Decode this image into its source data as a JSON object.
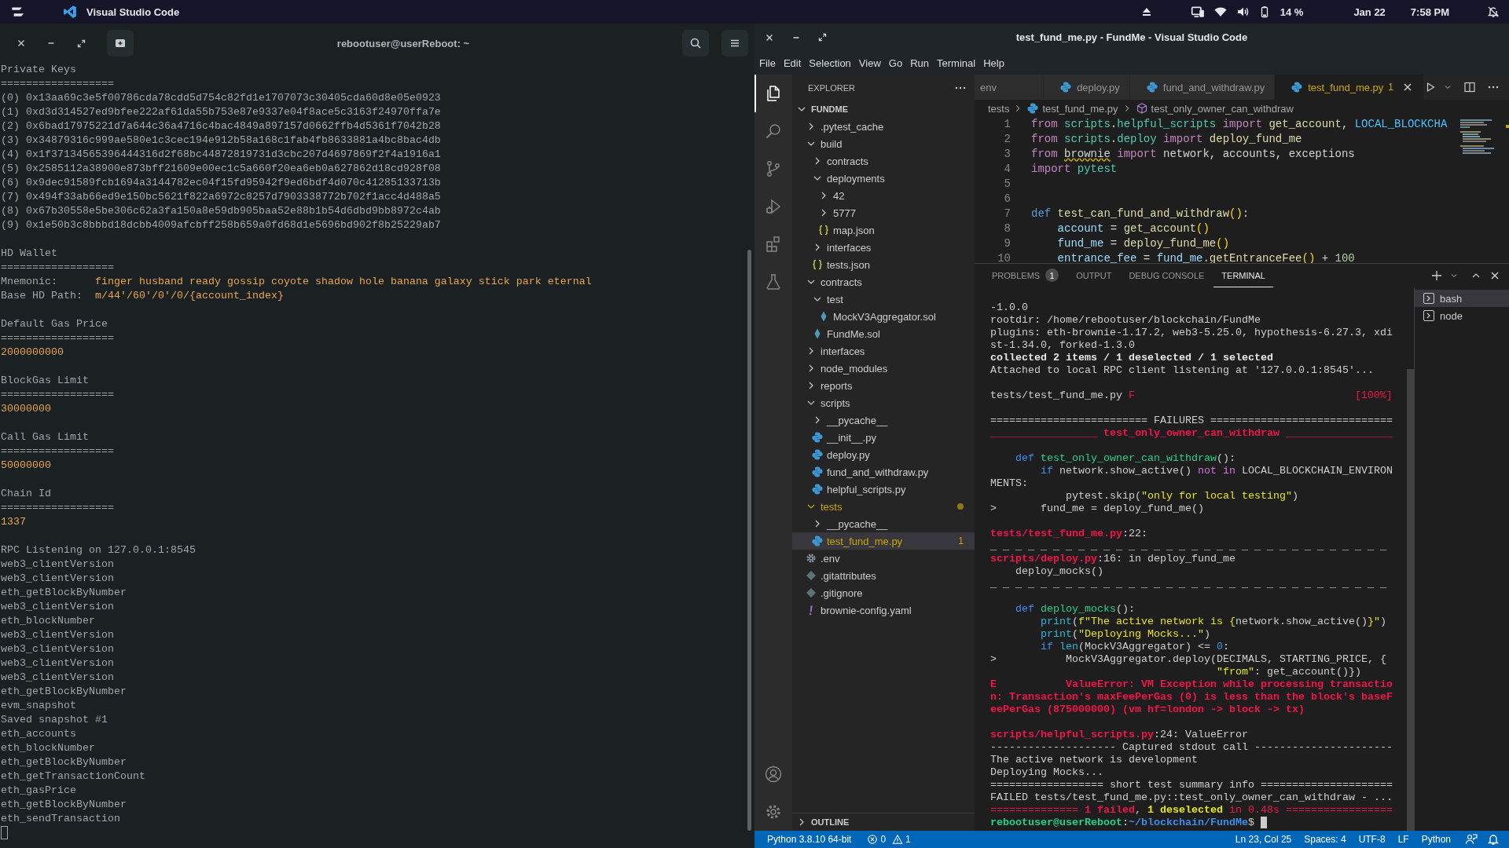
{
  "top_bar": {
    "app_name": "Visual Studio Code",
    "battery": "14 %",
    "date": "Jan 22",
    "time": "7:58 PM"
  },
  "terminal_window": {
    "title": "rebootuser@userReboot: ~",
    "lines": [
      {
        "kind": "plain",
        "text": "Private Keys"
      },
      {
        "kind": "plain",
        "text": "=================="
      },
      {
        "kind": "plain",
        "text": "(0) 0x13aa69c3e5f00786cda78cdd5d754c82fd1e1707073c30405cda60d8e05e0923"
      },
      {
        "kind": "plain",
        "text": "(1) 0xd3d314527ed9bfee222af61da55b753e87e9337e04f8ace5c3163f24970ffa7e"
      },
      {
        "kind": "plain",
        "text": "(2) 0x6bad17975221d7a644c36a4716c4bac4849a897157d0662ffb4d5361f7042b28"
      },
      {
        "kind": "plain",
        "text": "(3) 0x34879316c999ae580e1c3cec194e912b58a168c1fab4fb8633881a4bc8bac4db"
      },
      {
        "kind": "plain",
        "text": "(4) 0x1f37134565396444316d2f68bc44872819731d3cbc207d4697869f2f4a1916a1"
      },
      {
        "kind": "plain",
        "text": "(5) 0x2585112a38900e873bff21609e00ec1c5a660f20ea6eb0a627862d18cd928f08"
      },
      {
        "kind": "plain",
        "text": "(6) 0x9dec91589fcb1694a3144782ec04f15fd95942f9ed6bdf4d070c41285133713b"
      },
      {
        "kind": "plain",
        "text": "(7) 0x494f33ab66ed9e150bc5621f822a6972c8257d7903338772b702f1acc4d488a5"
      },
      {
        "kind": "plain",
        "text": "(8) 0x67b30558e5be306c62a3fa150a8e59db905baa52e88b1b54d6dbd9bb8972c4ab"
      },
      {
        "kind": "plain",
        "text": "(9) 0x1e50b3c8bbbd18dcbb4009afcbff258b659a0fd68d1e5696bd902f8b25229ab7"
      },
      {
        "kind": "gap"
      },
      {
        "kind": "plain",
        "text": "HD Wallet"
      },
      {
        "kind": "plain",
        "text": "=================="
      },
      {
        "kind": "pair",
        "label": "Mnemonic:",
        "value": "finger husband ready gossip coyote shadow hole banana galaxy stick park eternal"
      },
      {
        "kind": "pair",
        "label": "Base HD Path:",
        "value": "m/44'/60'/0'/0/{account_index}"
      },
      {
        "kind": "gap"
      },
      {
        "kind": "plain",
        "text": "Default Gas Price"
      },
      {
        "kind": "plain",
        "text": "=================="
      },
      {
        "kind": "value",
        "text": "2000000000"
      },
      {
        "kind": "gap"
      },
      {
        "kind": "plain",
        "text": "BlockGas Limit"
      },
      {
        "kind": "plain",
        "text": "=================="
      },
      {
        "kind": "value",
        "text": "30000000"
      },
      {
        "kind": "gap"
      },
      {
        "kind": "plain",
        "text": "Call Gas Limit"
      },
      {
        "kind": "plain",
        "text": "=================="
      },
      {
        "kind": "value",
        "text": "50000000"
      },
      {
        "kind": "gap"
      },
      {
        "kind": "plain",
        "text": "Chain Id"
      },
      {
        "kind": "plain",
        "text": "=================="
      },
      {
        "kind": "value",
        "text": "1337"
      },
      {
        "kind": "gap"
      },
      {
        "kind": "plain",
        "text": "RPC Listening on 127.0.0.1:8545"
      },
      {
        "kind": "plain",
        "text": "web3_clientVersion"
      },
      {
        "kind": "plain",
        "text": "web3_clientVersion"
      },
      {
        "kind": "plain",
        "text": "eth_getBlockByNumber"
      },
      {
        "kind": "plain",
        "text": "web3_clientVersion"
      },
      {
        "kind": "plain",
        "text": "eth_blockNumber"
      },
      {
        "kind": "plain",
        "text": "web3_clientVersion"
      },
      {
        "kind": "plain",
        "text": "web3_clientVersion"
      },
      {
        "kind": "plain",
        "text": "web3_clientVersion"
      },
      {
        "kind": "plain",
        "text": "web3_clientVersion"
      },
      {
        "kind": "plain",
        "text": "eth_getBlockByNumber"
      },
      {
        "kind": "plain",
        "text": "evm_snapshot"
      },
      {
        "kind": "plain",
        "text": "Saved snapshot #1"
      },
      {
        "kind": "plain",
        "text": "eth_accounts"
      },
      {
        "kind": "plain",
        "text": "eth_blockNumber"
      },
      {
        "kind": "plain",
        "text": "eth_getBlockByNumber"
      },
      {
        "kind": "plain",
        "text": "eth_getTransactionCount"
      },
      {
        "kind": "plain",
        "text": "eth_gasPrice"
      },
      {
        "kind": "plain",
        "text": "eth_getBlockByNumber"
      },
      {
        "kind": "plain",
        "text": "eth_sendTransaction"
      },
      {
        "kind": "cursor"
      }
    ]
  },
  "vscode": {
    "title": "test_fund_me.py - FundMe - Visual Studio Code",
    "menu": [
      "File",
      "Edit",
      "Selection",
      "View",
      "Go",
      "Run",
      "Terminal",
      "Help"
    ],
    "activity_bar": [
      {
        "kind": "explorer",
        "selected": true
      },
      {
        "kind": "search",
        "selected": false
      },
      {
        "kind": "source_control",
        "selected": false
      },
      {
        "kind": "run_debug",
        "selected": false
      },
      {
        "kind": "extensions",
        "selected": false
      },
      {
        "kind": "testing",
        "selected": false
      },
      {
        "kind": "accounts",
        "selected": false
      },
      {
        "kind": "manage",
        "selected": false
      }
    ],
    "explorer": {
      "title": "EXPLORER",
      "root": "FUNDME",
      "outline": "OUTLINE",
      "tree": [
        {
          "label": ".pytest_cache",
          "kind": "folder",
          "expanded": false,
          "selected": false
        },
        {
          "label": "build",
          "kind": "folder",
          "expanded": true,
          "selected": false,
          "children": [
            {
              "label": "contracts",
              "kind": "folder",
              "expanded": false,
              "selected": false
            },
            {
              "label": "deployments",
              "kind": "folder",
              "expanded": true,
              "selected": false,
              "children": [
                {
                  "label": "42",
                  "kind": "folder",
                  "expanded": false,
                  "selected": false
                },
                {
                  "label": "5777",
                  "kind": "folder",
                  "expanded": false,
                  "selected": false
                },
                {
                  "label": "map.json",
                  "kind": "json",
                  "selected": false
                }
              ]
            },
            {
              "label": "interfaces",
              "kind": "folder",
              "expanded": false,
              "selected": false
            },
            {
              "label": "tests.json",
              "kind": "json",
              "selected": false
            }
          ]
        },
        {
          "label": "contracts",
          "kind": "folder",
          "expanded": true,
          "selected": false,
          "children": [
            {
              "label": "test",
              "kind": "folder",
              "expanded": true,
              "selected": false,
              "children": [
                {
                  "label": "MockV3Aggregator.sol",
                  "kind": "solidity",
                  "selected": false
                }
              ]
            },
            {
              "label": "FundMe.sol",
              "kind": "solidity",
              "selected": false
            }
          ]
        },
        {
          "label": "interfaces",
          "kind": "folder",
          "expanded": false,
          "selected": false
        },
        {
          "label": "node_modules",
          "kind": "folder",
          "expanded": false,
          "selected": false
        },
        {
          "label": "reports",
          "kind": "folder",
          "expanded": false,
          "selected": false
        },
        {
          "label": "scripts",
          "kind": "folder",
          "expanded": true,
          "selected": false,
          "children": [
            {
              "label": "__pycache__",
              "kind": "folder",
              "expanded": false,
              "selected": false
            },
            {
              "label": "__init__.py",
              "kind": "python",
              "selected": false
            },
            {
              "label": "deploy.py",
              "kind": "python",
              "selected": false
            },
            {
              "label": "fund_and_withdraw.py",
              "kind": "python",
              "selected": false
            },
            {
              "label": "helpful_scripts.py",
              "kind": "python",
              "selected": false
            }
          ]
        },
        {
          "label": "tests",
          "kind": "folder",
          "expanded": true,
          "selected": false,
          "warning": true,
          "children": [
            {
              "label": "__pycache__",
              "kind": "folder",
              "expanded": false,
              "selected": false
            },
            {
              "label": "test_fund_me.py",
              "kind": "python",
              "selected": true,
              "warning": true,
              "badge": "1"
            }
          ]
        },
        {
          "label": ".env",
          "kind": "settings",
          "selected": false
        },
        {
          "label": ".gitattributes",
          "kind": "git",
          "selected": false
        },
        {
          "label": ".gitignore",
          "kind": "git",
          "selected": false
        },
        {
          "label": "brownie-config.yaml",
          "kind": "yaml",
          "selected": false
        }
      ]
    },
    "tabs": [
      {
        "label": "env",
        "kind": "plain",
        "selected": false
      },
      {
        "label": "deploy.py",
        "kind": "python",
        "selected": false
      },
      {
        "label": "fund_and_withdraw.py",
        "kind": "python",
        "selected": false
      },
      {
        "label": "test_fund_me.py",
        "kind": "python",
        "selected": true,
        "problems": "1"
      }
    ],
    "breadcrumbs": [
      {
        "label": "tests",
        "kind": "folder"
      },
      {
        "label": "test_fund_me.py",
        "kind": "python"
      },
      {
        "label": "test_only_owner_can_withdraw",
        "kind": "method"
      }
    ],
    "code": [
      {
        "number": "1",
        "tokens": [
          {
            "text": "from ",
            "kind": "keyword"
          },
          {
            "text": "scripts",
            "kind": "module"
          },
          {
            "text": ".",
            "kind": "plain"
          },
          {
            "text": "helpful_scripts ",
            "kind": "module"
          },
          {
            "text": "import ",
            "kind": "keyword"
          },
          {
            "text": "get_account",
            "kind": "function"
          },
          {
            "text": ", ",
            "kind": "plain"
          },
          {
            "text": "LOCAL_BLOCKCHA",
            "kind": "constant"
          }
        ]
      },
      {
        "number": "2",
        "tokens": [
          {
            "text": "from ",
            "kind": "keyword"
          },
          {
            "text": "scripts",
            "kind": "module"
          },
          {
            "text": ".",
            "kind": "plain"
          },
          {
            "text": "deploy ",
            "kind": "module"
          },
          {
            "text": "import ",
            "kind": "keyword"
          },
          {
            "text": "deploy_fund_me",
            "kind": "function"
          }
        ]
      },
      {
        "number": "3",
        "tokens": [
          {
            "text": "from ",
            "kind": "keyword"
          },
          {
            "text": "brownie",
            "kind": "unresolved"
          },
          {
            "text": " import ",
            "kind": "keyword"
          },
          {
            "text": "network, accounts, exceptions",
            "kind": "plain"
          }
        ]
      },
      {
        "number": "4",
        "tokens": [
          {
            "text": "import ",
            "kind": "keyword"
          },
          {
            "text": "pytest",
            "kind": "module"
          }
        ]
      },
      {
        "number": "5"
      },
      {
        "number": "6"
      },
      {
        "number": "7",
        "tokens": [
          {
            "text": "def ",
            "kind": "storage"
          },
          {
            "text": "test_can_fund_and_withdraw",
            "kind": "function"
          },
          {
            "text": "()",
            "kind": "bracket"
          },
          {
            "text": ":",
            "kind": "plain"
          }
        ]
      },
      {
        "number": "8",
        "tokens": [
          {
            "text": "    account",
            "kind": "variable"
          },
          {
            "text": " = ",
            "kind": "plain"
          },
          {
            "text": "get_account",
            "kind": "function"
          },
          {
            "text": "()",
            "kind": "bracket"
          }
        ]
      },
      {
        "number": "9",
        "tokens": [
          {
            "text": "    fund_me",
            "kind": "variable"
          },
          {
            "text": " = ",
            "kind": "plain"
          },
          {
            "text": "deploy_fund_me",
            "kind": "function"
          },
          {
            "text": "()",
            "kind": "bracket"
          }
        ]
      },
      {
        "number": "10",
        "tokens": [
          {
            "text": "    entrance_fee",
            "kind": "variable"
          },
          {
            "text": " = ",
            "kind": "plain"
          },
          {
            "text": "fund_me",
            "kind": "variable"
          },
          {
            "text": ".",
            "kind": "plain"
          },
          {
            "text": "getEntranceFee",
            "kind": "function"
          },
          {
            "text": "()",
            "kind": "bracket"
          },
          {
            "text": " + ",
            "kind": "plain"
          },
          {
            "text": "100",
            "kind": "number"
          }
        ]
      }
    ],
    "panel": {
      "tabs": [
        {
          "label": "PROBLEMS",
          "badge": "1",
          "selected": false
        },
        {
          "label": "OUTPUT",
          "selected": false
        },
        {
          "label": "DEBUG CONSOLE",
          "selected": false
        },
        {
          "label": "TERMINAL",
          "selected": true
        }
      ],
      "lines": [
        {
          "kind": "text",
          "segments": [
            {
              "text": "-1.0.0",
              "kind": "plain"
            }
          ]
        },
        {
          "kind": "text",
          "segments": [
            {
              "text": "rootdir: /home/rebootuser/blockchain/FundMe",
              "kind": "plain"
            }
          ]
        },
        {
          "kind": "text",
          "segments": [
            {
              "text": "plugins: eth-brownie-1.17.2, web3-5.25.0, hypothesis-6.27.3, xdi",
              "kind": "plain"
            }
          ]
        },
        {
          "kind": "text",
          "segments": [
            {
              "text": "st-1.34.0, forked-1.3.0",
              "kind": "plain"
            }
          ]
        },
        {
          "kind": "text",
          "segments": [
            {
              "text": "collected 2 items / 1 deselected / 1 selected",
              "kind": "bold"
            }
          ]
        },
        {
          "kind": "text",
          "segments": [
            {
              "text": "Attached to local RPC client listening at '127.0.0.1:8545'...",
              "kind": "plain"
            }
          ]
        },
        {
          "kind": "gap"
        },
        {
          "kind": "text",
          "segments": [
            {
              "text": "tests/test_fund_me.py ",
              "kind": "plain"
            },
            {
              "text": "F",
              "kind": "red"
            }
          ],
          "right": [
            {
              "text": "[100%]",
              "kind": "red"
            }
          ]
        },
        {
          "kind": "gap"
        },
        {
          "kind": "text",
          "segments": [
            {
              "text": "========================= FAILURES =============================",
              "kind": "plain"
            }
          ]
        },
        {
          "kind": "text",
          "segments": [
            {
              "text": "_________________ ",
              "kind": "red"
            },
            {
              "text": "test_only_owner_can_withdraw",
              "kind": "red_bold"
            },
            {
              "text": " _________________",
              "kind": "red"
            }
          ]
        },
        {
          "kind": "gap"
        },
        {
          "kind": "text",
          "segments": [
            {
              "text": "    def",
              "kind": "blue"
            },
            {
              "text": " test_only_owner_can_withdraw",
              "kind": "green"
            },
            {
              "text": "():",
              "kind": "plain"
            }
          ]
        },
        {
          "kind": "text",
          "segments": [
            {
              "text": "        if",
              "kind": "blue"
            },
            {
              "text": " network.show_active() ",
              "kind": "plain"
            },
            {
              "text": "not in",
              "kind": "magenta"
            },
            {
              "text": " LOCAL_BLOCKCHAIN_ENVIRON",
              "kind": "plain"
            }
          ]
        },
        {
          "kind": "text",
          "segments": [
            {
              "text": "MENTS:",
              "kind": "plain"
            }
          ]
        },
        {
          "kind": "text",
          "segments": [
            {
              "text": "            pytest.skip(",
              "kind": "plain"
            },
            {
              "text": "\"only for local testing\"",
              "kind": "yellow"
            },
            {
              "text": ")",
              "kind": "plain"
            }
          ]
        },
        {
          "kind": "text",
          "segments": [
            {
              "text": ">       fund_me = deploy_fund_me()",
              "kind": "plain"
            }
          ]
        },
        {
          "kind": "gap"
        },
        {
          "kind": "text",
          "segments": [
            {
              "text": "tests/test_fund_me.py",
              "kind": "red_bold"
            },
            {
              "text": ":22:",
              "kind": "plain"
            }
          ]
        },
        {
          "kind": "text",
          "segments": [
            {
              "text": "_ _ _ _ _ _ _ _ _ _ _ _ _ _ _ _ _ _ _ _ _ _ _ _ _ _ _ _ _ _ _ _",
              "kind": "plain"
            }
          ]
        },
        {
          "kind": "text",
          "segments": [
            {
              "text": "scripts/deploy.py",
              "kind": "red_bold"
            },
            {
              "text": ":16: in deploy_fund_me",
              "kind": "plain"
            }
          ]
        },
        {
          "kind": "text",
          "segments": [
            {
              "text": "    deploy_mocks()",
              "kind": "plain"
            }
          ]
        },
        {
          "kind": "text",
          "segments": [
            {
              "text": "_ _ _ _ _ _ _ _ _ _ _ _ _ _ _ _ _ _ _ _ _ _ _ _ _ _ _ _ _ _ _ _",
              "kind": "plain"
            }
          ]
        },
        {
          "kind": "gap"
        },
        {
          "kind": "text",
          "segments": [
            {
              "text": "    def",
              "kind": "blue"
            },
            {
              "text": " deploy_mocks",
              "kind": "green"
            },
            {
              "text": "():",
              "kind": "plain"
            }
          ]
        },
        {
          "kind": "text",
          "segments": [
            {
              "text": "        print",
              "kind": "cyan"
            },
            {
              "text": "(",
              "kind": "plain"
            },
            {
              "text": "f\"The active network is {",
              "kind": "yellow"
            },
            {
              "text": "network.show_active()",
              "kind": "plain"
            },
            {
              "text": "}\"",
              "kind": "yellow"
            },
            {
              "text": ")",
              "kind": "plain"
            }
          ]
        },
        {
          "kind": "text",
          "segments": [
            {
              "text": "        print",
              "kind": "cyan"
            },
            {
              "text": "(",
              "kind": "plain"
            },
            {
              "text": "\"Deploying Mocks...\"",
              "kind": "yellow"
            },
            {
              "text": ")",
              "kind": "plain"
            }
          ]
        },
        {
          "kind": "text",
          "segments": [
            {
              "text": "        if ",
              "kind": "blue"
            },
            {
              "text": "len",
              "kind": "cyan"
            },
            {
              "text": "(MockV3Aggregator) <= ",
              "kind": "plain"
            },
            {
              "text": "0",
              "kind": "blue"
            },
            {
              "text": ":",
              "kind": "plain"
            }
          ]
        },
        {
          "kind": "text",
          "segments": [
            {
              "text": ">           MockV3Aggregator.deploy(DECIMALS, STARTING_PRICE, {",
              "kind": "plain"
            }
          ]
        },
        {
          "kind": "text",
          "segments": [
            {
              "text": "                                    \"from\"",
              "kind": "yellow"
            },
            {
              "text": ": get_account()})",
              "kind": "plain"
            }
          ]
        },
        {
          "kind": "text",
          "segments": [
            {
              "text": "E           ValueError: VM Exception while processing transactio",
              "kind": "red_bold"
            }
          ]
        },
        {
          "kind": "text",
          "segments": [
            {
              "text": "n: Transaction's maxFeePerGas (0) is less than the block's baseF",
              "kind": "red_bold"
            }
          ]
        },
        {
          "kind": "text",
          "segments": [
            {
              "text": "eePerGas (875000000) (vm hf=london -> block -> tx)",
              "kind": "red_bold"
            }
          ]
        },
        {
          "kind": "gap"
        },
        {
          "kind": "text",
          "segments": [
            {
              "text": "scripts/helpful_scripts.py",
              "kind": "red_bold"
            },
            {
              "text": ":24: ValueError",
              "kind": "plain"
            }
          ]
        },
        {
          "kind": "text",
          "segments": [
            {
              "text": "-------------------- Captured stdout call ----------------------",
              "kind": "plain"
            }
          ]
        },
        {
          "kind": "text",
          "segments": [
            {
              "text": "The active network is development",
              "kind": "plain"
            }
          ]
        },
        {
          "kind": "text",
          "segments": [
            {
              "text": "Deploying Mocks...",
              "kind": "plain"
            }
          ]
        },
        {
          "kind": "text",
          "segments": [
            {
              "text": "================== short test summary info =====================",
              "kind": "plain"
            }
          ]
        },
        {
          "kind": "text",
          "segments": [
            {
              "text": "FAILED tests/test_fund_me.py::test_only_owner_can_withdraw - ...",
              "kind": "plain"
            }
          ]
        },
        {
          "kind": "text",
          "segments": [
            {
              "text": "============== ",
              "kind": "red"
            },
            {
              "text": "1 failed",
              "kind": "red_bold"
            },
            {
              "text": ", ",
              "kind": "plain"
            },
            {
              "text": "1 deselected",
              "kind": "yellow_bold"
            },
            {
              "text": " in 0.48s =================",
              "kind": "red"
            }
          ]
        },
        {
          "kind": "prompt",
          "segments": [
            {
              "text": "rebootuser@userReboot",
              "kind": "green_bold"
            },
            {
              "text": ":",
              "kind": "plain"
            },
            {
              "text": "~/blockchain/FundMe",
              "kind": "blue_bold"
            },
            {
              "text": "$",
              "kind": "plain"
            }
          ]
        }
      ],
      "terminals": [
        {
          "label": "bash",
          "selected": true
        },
        {
          "label": "node",
          "selected": false
        }
      ]
    },
    "status_bar": {
      "interpreter": "Python 3.8.10 64-bit",
      "errors": "0",
      "warnings": "1",
      "items": [
        "Ln 23, Col 25",
        "Spaces: 4",
        "UTF-8",
        "LF",
        "Python"
      ]
    }
  }
}
